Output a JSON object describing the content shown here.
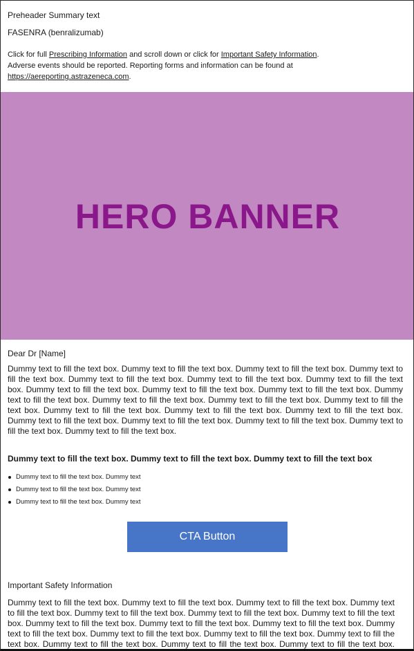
{
  "preheader": {
    "summary": "Preheader Summary text",
    "product": "FASENRA (benralizumab)",
    "pi_prefix": "Click for full ",
    "pi_link": "Prescribing Information",
    "pi_middle": " and scroll down or click for ",
    "isi_link": "Important Safety Information",
    "pi_end": ".",
    "adverse_text": "Adverse events should be reported. Reporting forms and information can be found at",
    "report_link": "https://aereporting.astrazeneca.com",
    "report_end": "."
  },
  "hero": {
    "text": "HERO BANNER",
    "background": "#c288c1",
    "text_color": "#8a188a"
  },
  "body": {
    "greeting": "Dear Dr [Name]",
    "paragraph": "Dummy text to fill the text box. Dummy text to fill the text box. Dummy text to fill the text box. Dummy text to fill the text box. Dummy text to fill the text box. Dummy text to fill the text box. Dummy text to fill the text box. Dummy text to fill the text box. Dummy text to fill the text box. Dummy text to fill the text box. Dummy text to fill the text box. Dummy text to fill the text box. Dummy text to fill the text box. Dummy text to fill the text box. Dummy text to fill the text box. Dummy text to fill the text box. Dummy text to fill the text box. Dummy text to fill the text box. Dummy text to fill the text box. Dummy text to fill the text box. Dummy text to fill the text box. Dummy text to fill the text box.",
    "subheading": "Dummy text to fill the text box. Dummy text to fill the text box. Dummy text to fill the text box",
    "bullets": [
      "Dummy text to fill the text box. Dummy text",
      "Dummy text to fill the text box. Dummy text",
      "Dummy text to fill the text box. Dummy text"
    ]
  },
  "cta": {
    "label": "CTA Button",
    "color": "#4776c8"
  },
  "isi": {
    "title": "Important Safety Information",
    "paragraph": "Dummy text to fill the text box. Dummy text to fill the text box. Dummy text to fill the text box. Dummy text to fill the text box. Dummy text to fill the text box. Dummy text to fill the text box. Dummy text to fill the text box. Dummy text to fill the text box. Dummy text to fill the text box. Dummy text to fill the text box. Dummy text to fill the text box. Dummy text to fill the text box. Dummy text to fill the text box. Dummy text to fill the text box. Dummy text to fill the text box. Dummy text to fill the text box. Dummy text to fill the text box. Dummy text to fill the text box. Dummy text to fill the text box. Dummy text to fill the"
  }
}
